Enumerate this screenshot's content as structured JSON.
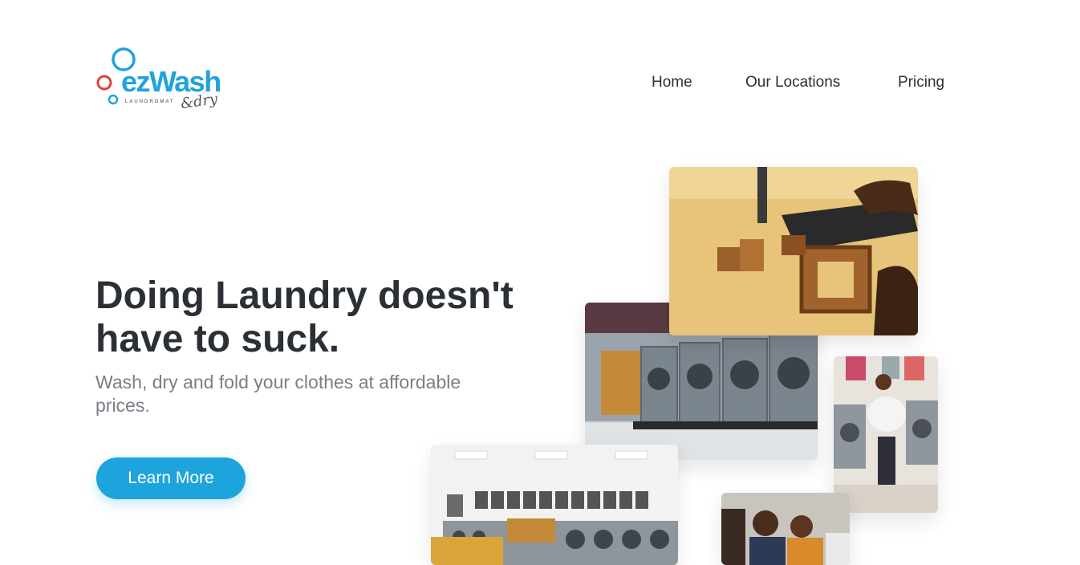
{
  "logo": {
    "brand": "ezWash",
    "tagline": "LAUNDROMAT",
    "suffix": "&dry"
  },
  "nav": {
    "items": [
      {
        "label": "Home"
      },
      {
        "label": "Our Locations"
      },
      {
        "label": "Pricing"
      }
    ]
  },
  "hero": {
    "title": "Doing Laundry doesn't have to suck.",
    "subtitle": "Wash, dry and fold your clothes at affordable prices.",
    "cta_label": "Learn More"
  },
  "colors": {
    "accent": "#1ea4dc",
    "logo_red": "#e0403a",
    "heading": "#2b2f36",
    "muted": "#7a7e86"
  }
}
